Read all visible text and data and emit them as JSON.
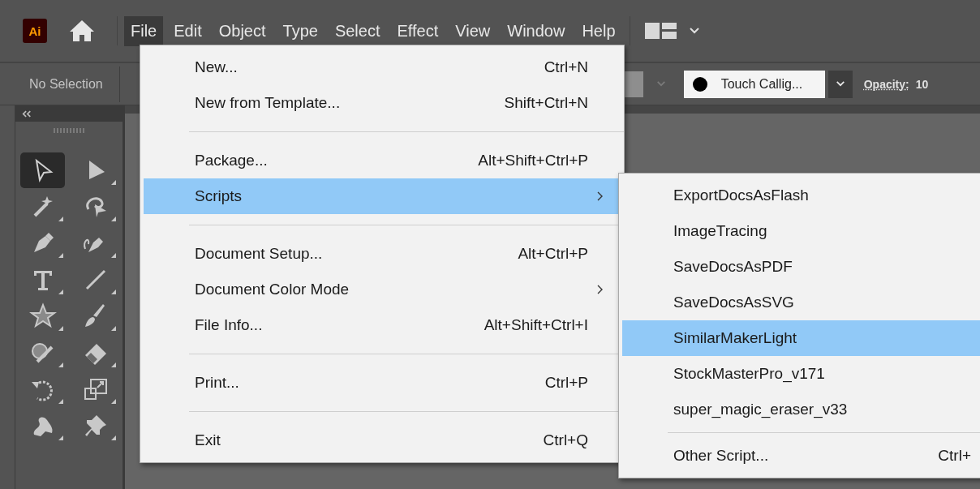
{
  "menu_bar": {
    "items": [
      {
        "label": "File",
        "selected": true
      },
      {
        "label": "Edit",
        "selected": false
      },
      {
        "label": "Object",
        "selected": false
      },
      {
        "label": "Type",
        "selected": false
      },
      {
        "label": "Select",
        "selected": false
      },
      {
        "label": "Effect",
        "selected": false
      },
      {
        "label": "View",
        "selected": false
      },
      {
        "label": "Window",
        "selected": false
      },
      {
        "label": "Help",
        "selected": false
      }
    ],
    "logo": "Ai"
  },
  "control_bar": {
    "selection": "No Selection",
    "brush": "Touch Callig...",
    "opacity_label": "Opacity:",
    "opacity_value": "10"
  },
  "toolbar": {
    "tools": [
      {
        "selected": true
      },
      {
        "selected": false
      },
      {
        "selected": false
      },
      {
        "selected": false
      },
      {
        "selected": false
      },
      {
        "selected": false
      },
      {
        "selected": false
      },
      {
        "selected": false
      },
      {
        "selected": false
      },
      {
        "selected": false
      },
      {
        "selected": false
      },
      {
        "selected": false
      },
      {
        "selected": false
      },
      {
        "selected": false
      },
      {
        "selected": false
      },
      {
        "selected": false
      }
    ]
  },
  "file_menu": {
    "items": [
      {
        "kind": "item",
        "label": "New...",
        "shortcut": "Ctrl+N",
        "selected": false
      },
      {
        "kind": "item",
        "label": "New from Template...",
        "shortcut": "Shift+Ctrl+N",
        "selected": false
      },
      {
        "kind": "separator"
      },
      {
        "kind": "item",
        "label": "Package...",
        "shortcut": "Alt+Shift+Ctrl+P",
        "selected": false
      },
      {
        "kind": "submenu",
        "label": "Scripts",
        "selected": true
      },
      {
        "kind": "separator"
      },
      {
        "kind": "item",
        "label": "Document Setup...",
        "shortcut": "Alt+Ctrl+P",
        "selected": false
      },
      {
        "kind": "submenu",
        "label": "Document Color Mode",
        "selected": false
      },
      {
        "kind": "item",
        "label": "File Info...",
        "shortcut": "Alt+Shift+Ctrl+I",
        "selected": false
      },
      {
        "kind": "separator"
      },
      {
        "kind": "item",
        "label": "Print...",
        "shortcut": "Ctrl+P",
        "selected": false
      },
      {
        "kind": "separator"
      },
      {
        "kind": "item",
        "label": "Exit",
        "shortcut": "Ctrl+Q",
        "selected": false
      }
    ]
  },
  "scripts_submenu": {
    "items": [
      {
        "kind": "item",
        "label": "ExportDocsAsFlash",
        "selected": false
      },
      {
        "kind": "item",
        "label": "ImageTracing",
        "selected": false
      },
      {
        "kind": "item",
        "label": "SaveDocsAsPDF",
        "selected": false
      },
      {
        "kind": "item",
        "label": "SaveDocsAsSVG",
        "selected": false
      },
      {
        "kind": "item",
        "label": "SimilarMakerLight",
        "selected": true
      },
      {
        "kind": "item",
        "label": "StockMasterPro_v171",
        "selected": false
      },
      {
        "kind": "item",
        "label": "super_magic_eraser_v33",
        "selected": false
      },
      {
        "kind": "separator"
      },
      {
        "kind": "item",
        "label": "Other Script...",
        "shortcut": "Ctrl+",
        "selected": false
      }
    ]
  }
}
